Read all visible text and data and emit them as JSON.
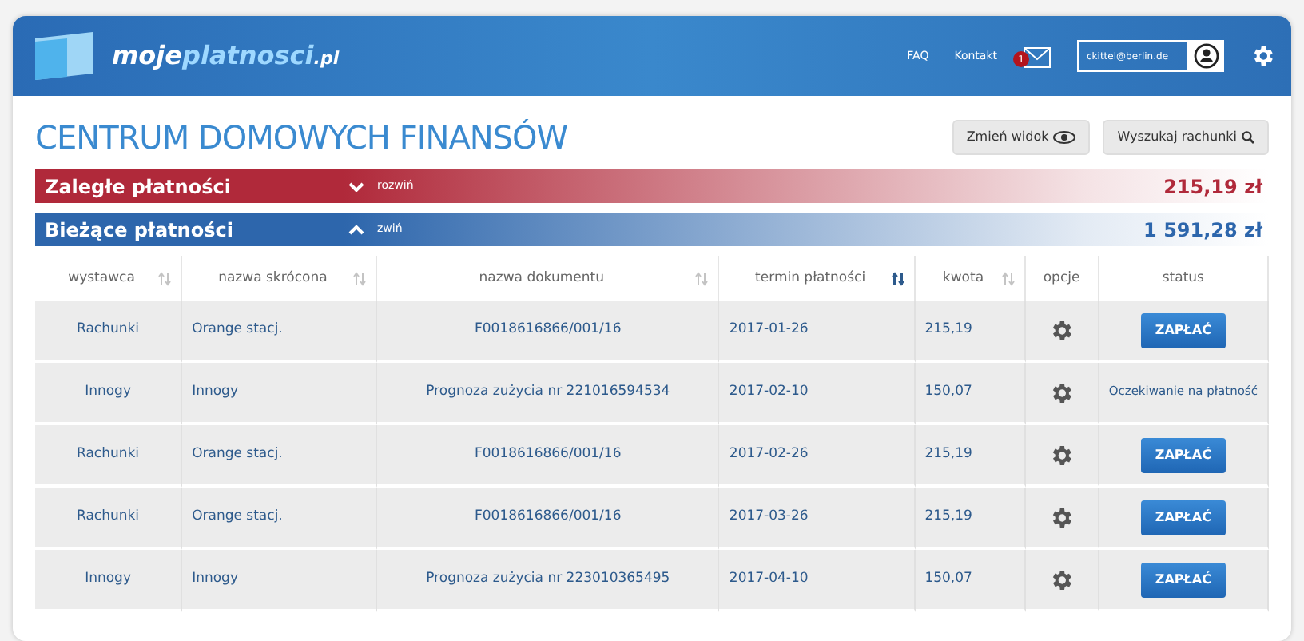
{
  "header": {
    "logo": {
      "brand": "moje",
      "accent": "platnosci",
      "suffix": ".pl"
    },
    "links": [
      "FAQ",
      "Kontakt"
    ],
    "mail_badge": "1",
    "user_email": "ckittel@berlin.de"
  },
  "title": "CENTRUM DOMOWYCH FINANSÓW",
  "toolbar": [
    "Zmień widok",
    "Wyszukaj rachunki"
  ],
  "sections": [
    {
      "label": "Zaległe płatności",
      "toggle": "rozwiń",
      "amount": "215,19 zł",
      "expanded": false,
      "color": "#b0293a"
    },
    {
      "label": "Bieżące płatności",
      "toggle": "zwiń",
      "amount": "1 591,28 zł",
      "expanded": true,
      "color": "#2d66ac"
    }
  ],
  "table": {
    "columns": [
      {
        "label": "wystawca",
        "sortable": true,
        "sorted": false
      },
      {
        "label": "nazwa skrócona",
        "sortable": true,
        "sorted": false
      },
      {
        "label": "nazwa dokumentu",
        "sortable": true,
        "sorted": false
      },
      {
        "label": "termin płatności",
        "sortable": true,
        "sorted": true
      },
      {
        "label": "kwota",
        "sortable": true,
        "sorted": false
      },
      {
        "label": "opcje",
        "sortable": false
      },
      {
        "label": "status",
        "sortable": false
      }
    ],
    "rows": [
      {
        "cells": [
          "Rachunki",
          "Orange stacj.",
          "F0018616866/001/16",
          "2017-01-26",
          "215,19"
        ],
        "status": {
          "kind": "button",
          "text": "ZAPŁAĆ"
        }
      },
      {
        "cells": [
          "Innogy",
          "Innogy",
          "Prognoza zużycia nr 221016594534",
          "2017-02-10",
          "150,07"
        ],
        "status": {
          "kind": "text",
          "text": "Oczekiwanie na płatność"
        }
      },
      {
        "cells": [
          "Rachunki",
          "Orange stacj.",
          "F0018616866/001/16",
          "2017-02-26",
          "215,19"
        ],
        "status": {
          "kind": "button",
          "text": "ZAPŁAĆ"
        }
      },
      {
        "cells": [
          "Rachunki",
          "Orange stacj.",
          "F0018616866/001/16",
          "2017-03-26",
          "215,19"
        ],
        "status": {
          "kind": "button",
          "text": "ZAPŁAĆ"
        }
      },
      {
        "cells": [
          "Innogy",
          "Innogy",
          "Prognoza zużycia nr 223010365495",
          "2017-04-10",
          "150,07"
        ],
        "status": {
          "kind": "button",
          "text": "ZAPŁAĆ"
        }
      }
    ]
  }
}
